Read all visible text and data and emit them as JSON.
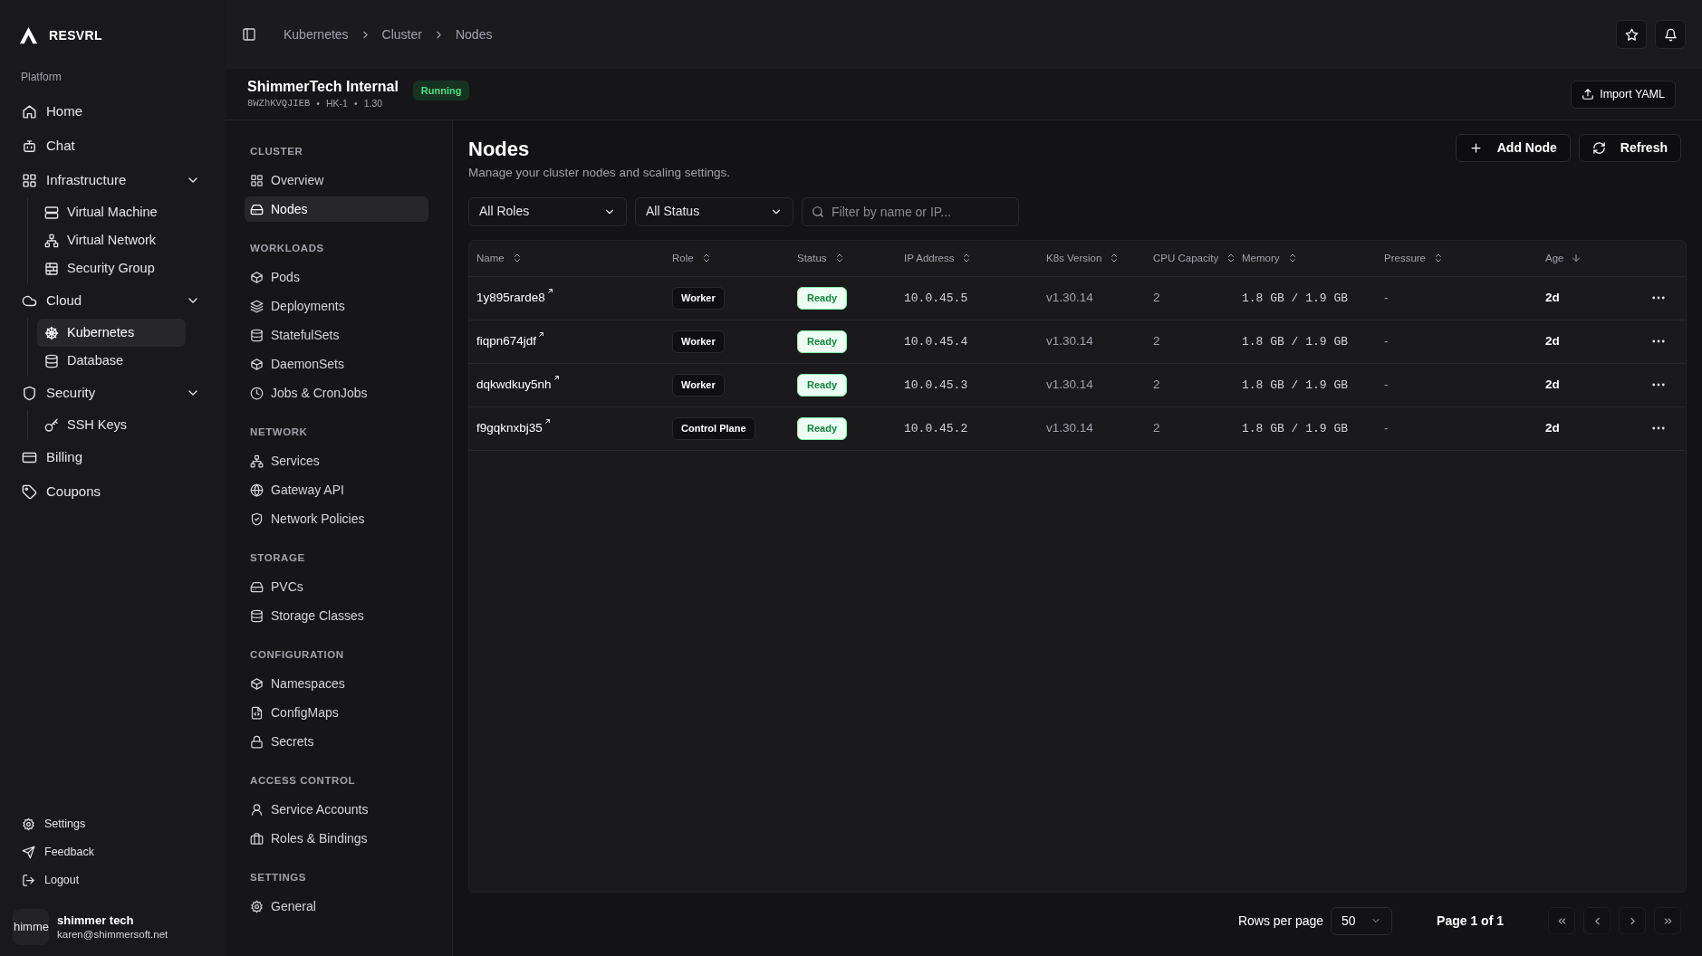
{
  "app": {
    "name": "RESVRL"
  },
  "sidebar": {
    "section": "Platform",
    "items": [
      {
        "label": "Home",
        "selected": false
      },
      {
        "label": "Chat",
        "selected": false
      },
      {
        "label": "Infrastructure",
        "selected": false,
        "expanded": true,
        "children": [
          {
            "label": "Virtual Machine",
            "selected": false
          },
          {
            "label": "Virtual Network",
            "selected": false
          },
          {
            "label": "Security Group",
            "selected": false
          }
        ]
      },
      {
        "label": "Cloud",
        "selected": false,
        "expanded": true,
        "children": [
          {
            "label": "Kubernetes",
            "selected": true
          },
          {
            "label": "Database",
            "selected": false
          }
        ]
      },
      {
        "label": "Security",
        "selected": false,
        "expanded": true,
        "children": [
          {
            "label": "SSH Keys",
            "selected": false
          }
        ]
      },
      {
        "label": "Billing",
        "selected": false
      },
      {
        "label": "Coupons",
        "selected": false
      }
    ],
    "footer_links": [
      "Settings",
      "Feedback",
      "Logout"
    ]
  },
  "user": {
    "avatar_text": "himme",
    "name": "shimmer tech",
    "email": "karen@shimmersoft.net"
  },
  "breadcrumbs": [
    "Kubernetes",
    "Cluster",
    "Nodes"
  ],
  "cluster": {
    "name": "ShimmerTech Internal",
    "meta": [
      "8WZhKVQJIEB",
      "HK-1",
      "1.30"
    ],
    "meta_separator": "•",
    "status": "Running",
    "import_button": "Import YAML"
  },
  "subnav": [
    {
      "heading": "CLUSTER",
      "items": [
        {
          "label": "Overview",
          "selected": false
        },
        {
          "label": "Nodes",
          "selected": true
        }
      ]
    },
    {
      "heading": "WORKLOADS",
      "items": [
        {
          "label": "Pods",
          "selected": false
        },
        {
          "label": "Deployments",
          "selected": false
        },
        {
          "label": "StatefulSets",
          "selected": false
        },
        {
          "label": "DaemonSets",
          "selected": false
        },
        {
          "label": "Jobs & CronJobs",
          "selected": false
        }
      ]
    },
    {
      "heading": "NETWORK",
      "items": [
        {
          "label": "Services",
          "selected": false
        },
        {
          "label": "Gateway API",
          "selected": false
        },
        {
          "label": "Network Policies",
          "selected": false
        }
      ]
    },
    {
      "heading": "STORAGE",
      "items": [
        {
          "label": "PVCs",
          "selected": false
        },
        {
          "label": "Storage Classes",
          "selected": false
        }
      ]
    },
    {
      "heading": "CONFIGURATION",
      "items": [
        {
          "label": "Namespaces",
          "selected": false
        },
        {
          "label": "ConfigMaps",
          "selected": false
        },
        {
          "label": "Secrets",
          "selected": false
        }
      ]
    },
    {
      "heading": "ACCESS CONTROL",
      "items": [
        {
          "label": "Service Accounts",
          "selected": false
        },
        {
          "label": "Roles & Bindings",
          "selected": false
        }
      ]
    },
    {
      "heading": "SETTINGS",
      "items": [
        {
          "label": "General",
          "selected": false
        }
      ]
    }
  ],
  "page": {
    "title": "Nodes",
    "subtitle": "Manage your cluster nodes and scaling settings.",
    "buttons": [
      "Add Node",
      "Refresh"
    ]
  },
  "filters": {
    "role": "All Roles",
    "status": "All Status",
    "search": {
      "placeholder": "Filter by name or IP..."
    }
  },
  "table": {
    "columns": [
      {
        "label": "Name",
        "sorted": false
      },
      {
        "label": "Role",
        "sorted": false
      },
      {
        "label": "Status",
        "sorted": false
      },
      {
        "label": "IP Address",
        "sorted": false
      },
      {
        "label": "K8s Version",
        "sorted": false
      },
      {
        "label": "CPU Capacity",
        "sorted": false
      },
      {
        "label": "Memory",
        "sorted": false
      },
      {
        "label": "Pressure",
        "sorted": false
      },
      {
        "label": "Age",
        "sorted": true
      }
    ],
    "rows": [
      {
        "name": "1y895rarde8",
        "role": "Worker",
        "status": "Ready",
        "ip": "10.0.45.5",
        "version": "v1.30.14",
        "cpu": "2",
        "memory": "1.8 GB / 1.9 GB",
        "pressure": "-",
        "age": "2d"
      },
      {
        "name": "fiqpn674jdf",
        "role": "Worker",
        "status": "Ready",
        "ip": "10.0.45.4",
        "version": "v1.30.14",
        "cpu": "2",
        "memory": "1.8 GB / 1.9 GB",
        "pressure": "-",
        "age": "2d"
      },
      {
        "name": "dqkwdkuy5nh",
        "role": "Worker",
        "status": "Ready",
        "ip": "10.0.45.3",
        "version": "v1.30.14",
        "cpu": "2",
        "memory": "1.8 GB / 1.9 GB",
        "pressure": "-",
        "age": "2d"
      },
      {
        "name": "f9gqknxbj35",
        "role": "Control Plane",
        "status": "Ready",
        "ip": "10.0.45.2",
        "version": "v1.30.14",
        "cpu": "2",
        "memory": "1.8 GB / 1.9 GB",
        "pressure": "-",
        "age": "2d"
      }
    ]
  },
  "pagination": {
    "rows_per_page_label": "Rows per page",
    "rows_per_page": "50",
    "page": "Page 1 of 1"
  }
}
